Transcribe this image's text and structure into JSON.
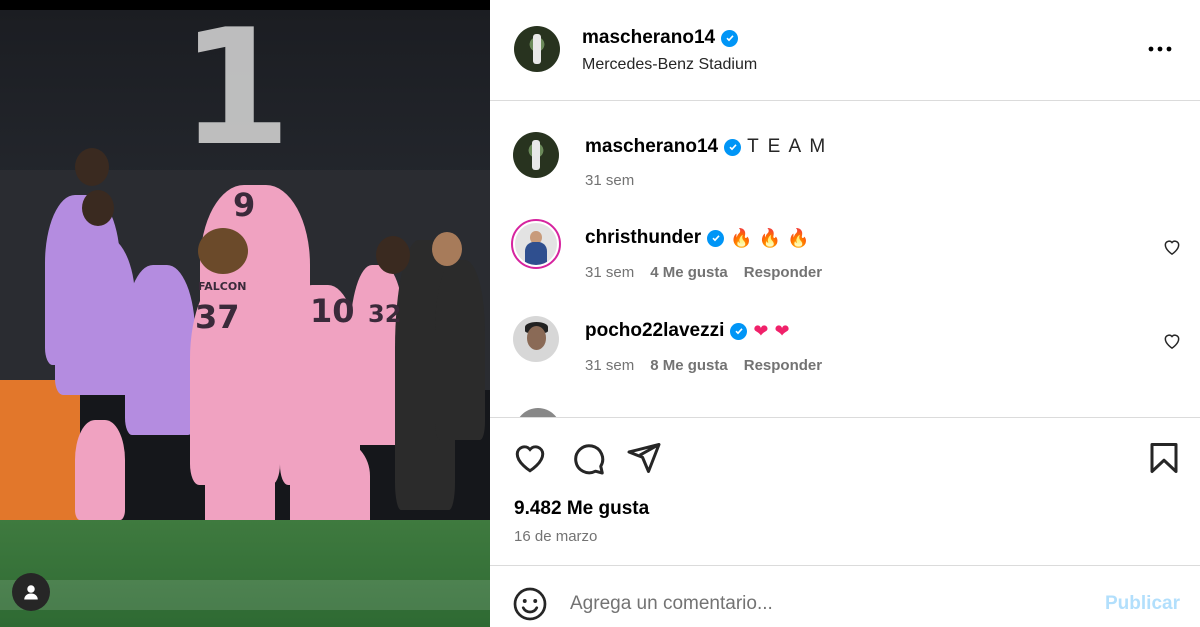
{
  "post": {
    "author": "mascherano14",
    "location": "Mercedes-Benz Stadium",
    "caption": "T E A M",
    "caption_time": "31 sem",
    "likes": "9.482 Me gusta",
    "date": "16 de marzo"
  },
  "photo": {
    "scoreboard": "1",
    "shirt_numbers": [
      "9",
      "37",
      "10",
      "32"
    ],
    "name_on_shirt": "FALCON"
  },
  "comments": [
    {
      "user": "christhunder",
      "emojis": [
        "🔥",
        "🔥",
        "🔥"
      ],
      "time": "31 sem",
      "likes": "4 Me gusta",
      "reply": "Responder"
    },
    {
      "user": "pocho22lavezzi",
      "emojis": [
        "❤",
        "❤"
      ],
      "time": "31 sem",
      "likes": "8 Me gusta",
      "reply": "Responder"
    }
  ],
  "icons": {
    "more": "more-options-icon",
    "verified": "verified-badge-icon",
    "like": "heart-icon",
    "comment": "comment-icon",
    "share": "share-icon",
    "save": "bookmark-icon",
    "emoji": "emoji-icon",
    "user_tag": "user-tag-icon"
  },
  "composer": {
    "placeholder": "Agrega un comentario...",
    "publish_label": "Publicar"
  },
  "colors": {
    "verified": "#0095f6",
    "publish_disabled": "#b2dffc",
    "secondary_text": "#737373",
    "divider": "#dbdbdb"
  }
}
